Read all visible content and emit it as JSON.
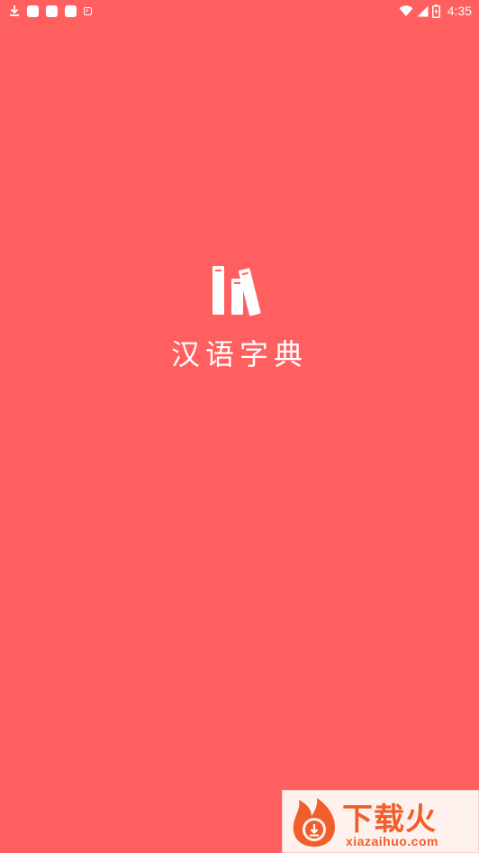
{
  "status_bar": {
    "time": "4:35",
    "left_icons": [
      "download-icon",
      "notification-icon",
      "notification-icon",
      "notification-icon",
      "app-notification-icon"
    ],
    "right_icons": [
      "wifi-icon",
      "cellular-signal-icon",
      "battery-charging-icon"
    ]
  },
  "splash": {
    "background_color": "#FF5F5E",
    "logo_icon": "books-icon",
    "title": "汉语字典"
  },
  "watermark": {
    "brand": "下载火",
    "url": "xiazaihuo.com",
    "brand_color": "#F25D2C"
  }
}
